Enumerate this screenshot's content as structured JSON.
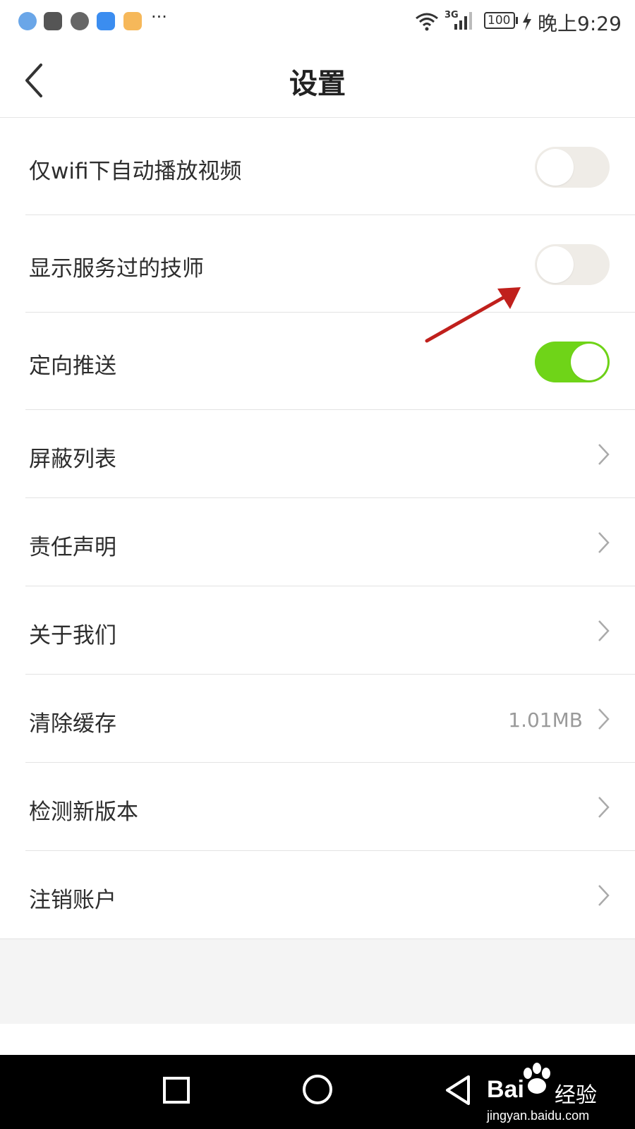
{
  "status_bar": {
    "network": "3G",
    "battery": "100",
    "time": "晚上9:29",
    "more": "···",
    "app_icons": [
      "browser-icon",
      "huawei-store-icon",
      "security-icon",
      "weather-icon",
      "notes-icon"
    ]
  },
  "header": {
    "title": "设置"
  },
  "toggle_rows": [
    {
      "label": "仅wifi下自动播放视频",
      "state": "off"
    },
    {
      "label": "显示服务过的技师",
      "state": "off"
    },
    {
      "label": "定向推送",
      "state": "on"
    }
  ],
  "link_rows": [
    {
      "label": "屏蔽列表"
    },
    {
      "label": "责任声明"
    },
    {
      "label": "关于我们"
    },
    {
      "label": "清除缓存",
      "value": "1.01MB"
    },
    {
      "label": "检测新版本"
    },
    {
      "label": "注销账户"
    }
  ],
  "annotation": {
    "color": "#c0201c"
  },
  "watermark": {
    "brand": "Bai",
    "cn": "经验",
    "url": "jingyan.baidu.com"
  },
  "colors": {
    "toggle_on": "#6fd418",
    "toggle_off": "#efece7"
  }
}
